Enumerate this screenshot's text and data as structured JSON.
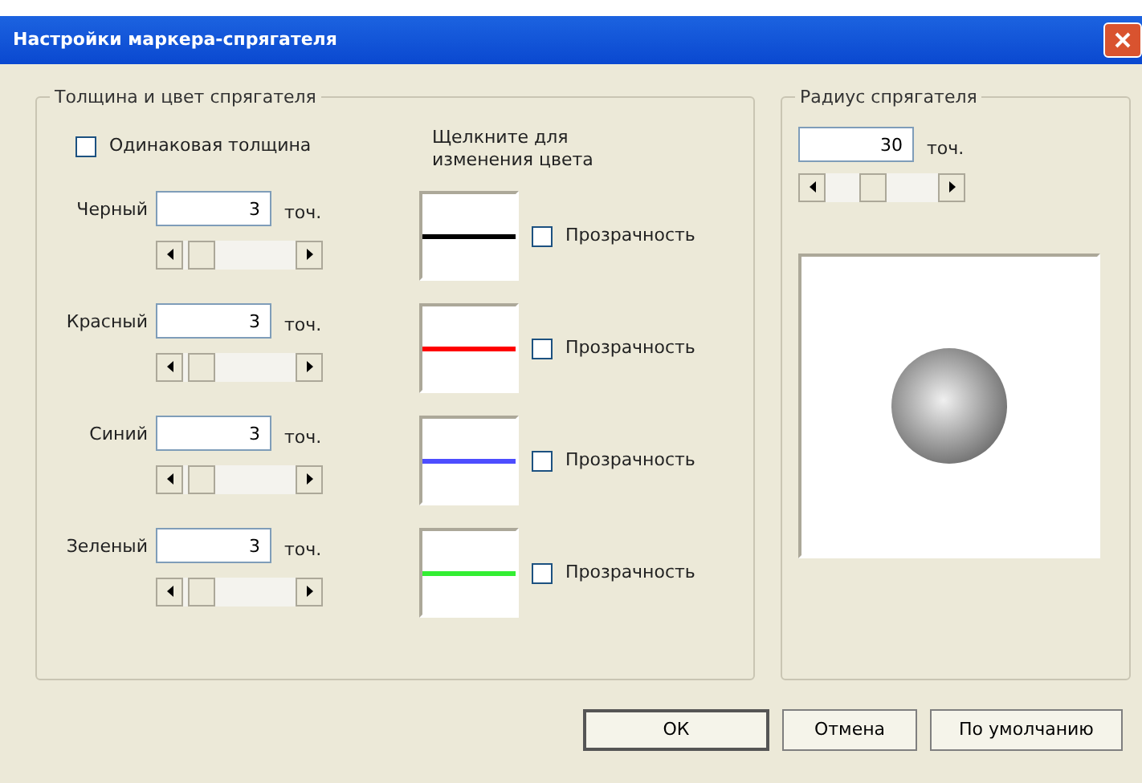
{
  "window": {
    "title": "Настройки маркера-спрягателя"
  },
  "thickness_group": {
    "title": "Толщина и цвет спрягателя",
    "same_thickness": {
      "label": "Одинаковая толщина",
      "checked": false
    },
    "color_hint": "Щелкните для изменения цвета",
    "rows": [
      {
        "label": "Черный",
        "value": "3",
        "unit": "точ.",
        "level": 0.05,
        "color": "#000000",
        "transparency": {
          "label": "Прозрачность",
          "checked": false
        }
      },
      {
        "label": "Красный",
        "value": "3",
        "unit": "точ.",
        "level": 0.05,
        "color": "#ff0000",
        "transparency": {
          "label": "Прозрачность",
          "checked": false
        }
      },
      {
        "label": "Синий",
        "value": "3",
        "unit": "точ.",
        "level": 0.05,
        "color": "#4d4dff",
        "transparency": {
          "label": "Прозрачность",
          "checked": false
        }
      },
      {
        "label": "Зеленый",
        "value": "3",
        "unit": "точ.",
        "level": 0.05,
        "color": "#33ee33",
        "transparency": {
          "label": "Прозрачность",
          "checked": false
        }
      }
    ]
  },
  "radius_group": {
    "title": "Радиус спрягателя",
    "value": "30",
    "unit": "точ.",
    "level": 0.4
  },
  "buttons": [
    {
      "label": "ОК",
      "default": true
    },
    {
      "label": "Отмена",
      "default": false
    },
    {
      "label": "По умолчанию",
      "default": false
    }
  ]
}
